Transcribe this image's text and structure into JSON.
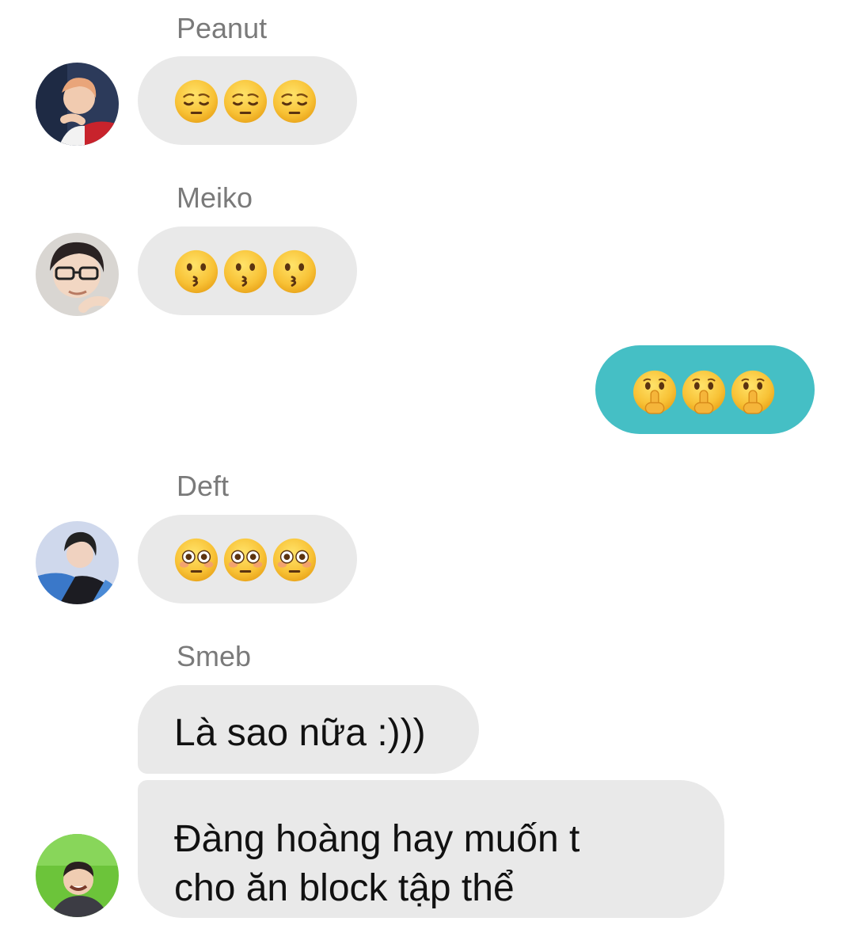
{
  "messages": [
    {
      "sender": "Peanut",
      "avatar": "peanut-avatar",
      "emoji": [
        "😔",
        "😔",
        "😔"
      ],
      "emoji_icon": "pensive-face-icon"
    },
    {
      "sender": "Meiko",
      "avatar": "meiko-avatar",
      "emoji": [
        "😗",
        "😗",
        "😗"
      ],
      "emoji_icon": "kissing-face-icon"
    },
    {
      "sender": "me",
      "emoji": [
        "🤫",
        "🤫",
        "🤫"
      ],
      "emoji_icon": "shushing-face-icon"
    },
    {
      "sender": "Deft",
      "avatar": "deft-avatar",
      "emoji": [
        "😳",
        "😳",
        "😳"
      ],
      "emoji_icon": "flushed-face-icon"
    },
    {
      "sender": "Smeb",
      "avatar": "smeb-avatar",
      "texts": [
        "Là sao nữa :)))",
        "Đàng hoàng hay muốn t\ncho ăn block tập thể"
      ]
    }
  ],
  "colors": {
    "incoming_bubble": "#e9e9e9",
    "outgoing_bubble": "#45bfc5",
    "sender_name": "#7a7a7a",
    "text": "#111111",
    "emoji_face": "#f8c236"
  }
}
